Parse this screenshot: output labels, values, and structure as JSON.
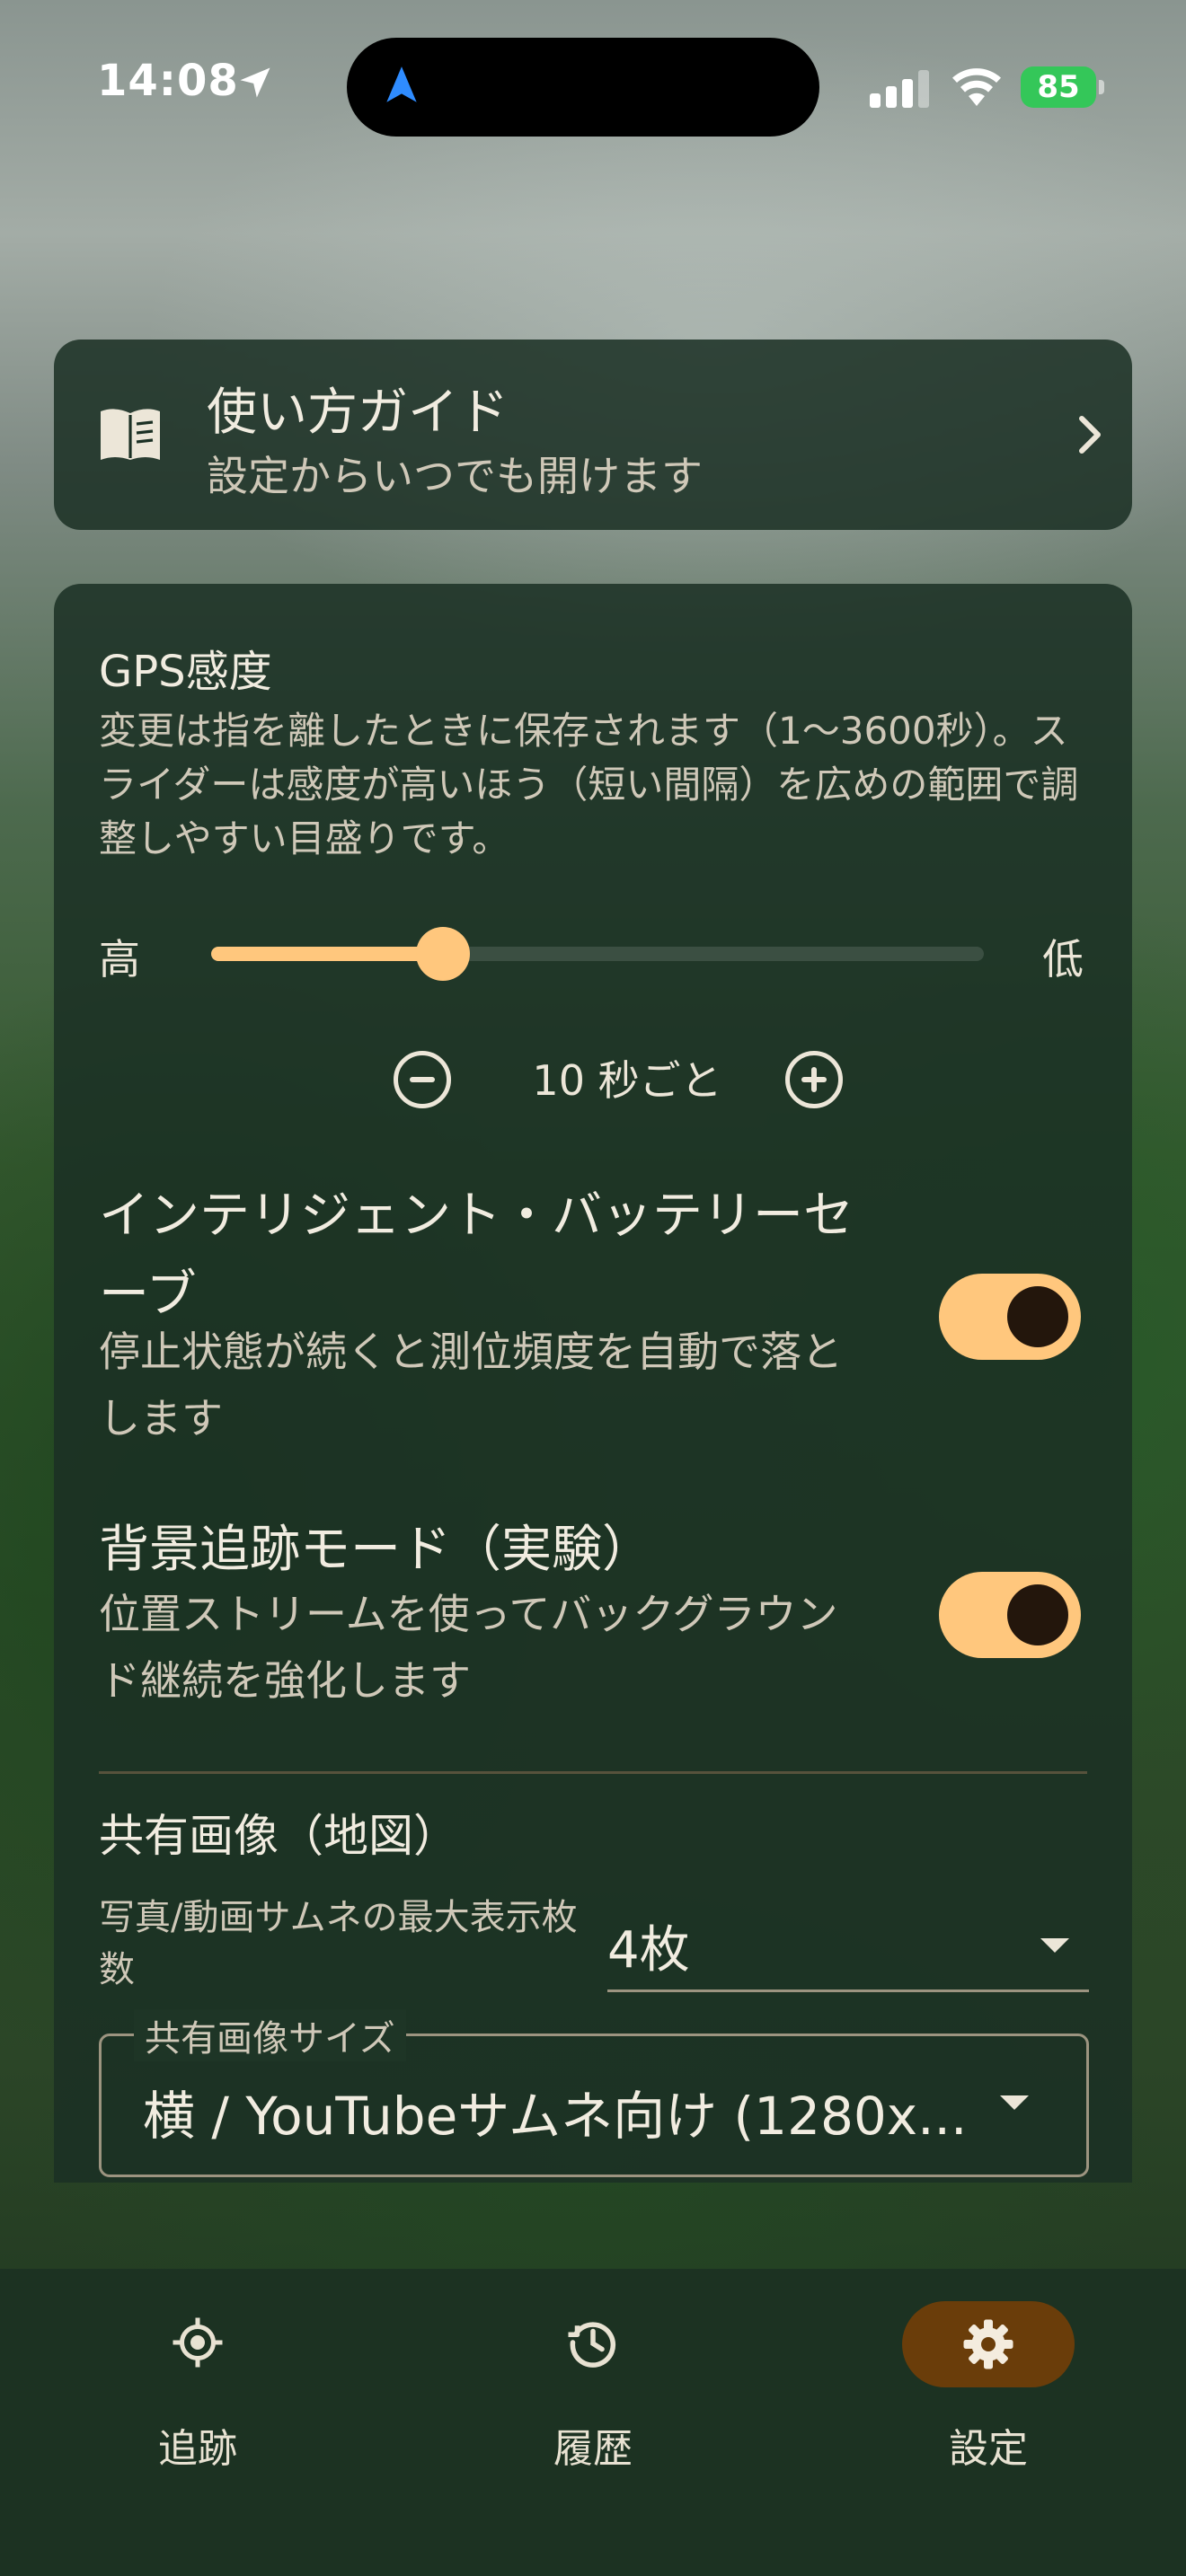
{
  "status_bar": {
    "time": "14:08",
    "battery": "85",
    "icons": [
      "location-arrow-icon",
      "navigation-icon",
      "cellular-signal-icon",
      "wifi-icon",
      "battery-icon"
    ]
  },
  "guide": {
    "title": "使い方ガイド",
    "subtitle": "設定からいつでも開けます",
    "icon": "book-icon"
  },
  "gps": {
    "title": "GPS感度",
    "description": "変更は指を離したときに保存されます（1〜3600秒）。スライダーは感度が高いほう（短い間隔）を広めの範囲で調整しやすい目盛りです。",
    "slider_left": "高",
    "slider_right": "低",
    "slider_position": 0.3,
    "interval_text": "10 秒ごと"
  },
  "options": [
    {
      "title": "インテリジェント・バッテリーセーブ",
      "description": "停止状態が続くと測位頻度を自動で落とします",
      "enabled": true
    },
    {
      "title": "背景追跡モード（実験）",
      "description": "位置ストリームを使ってバックグラウンド継続を強化します",
      "enabled": true
    }
  ],
  "share": {
    "title": "共有画像（地図）",
    "max_label": "写真/動画サムネの最大表示枚数",
    "max_value": "4枚",
    "size_label": "共有画像サイズ",
    "size_value": "横 / YouTubeサムネ向け (1280x..."
  },
  "nav": {
    "items": [
      {
        "label": "追跡",
        "icon": "gps-target-icon"
      },
      {
        "label": "履歴",
        "icon": "history-icon"
      },
      {
        "label": "設定",
        "icon": "gear-icon",
        "active": true
      }
    ]
  },
  "colors": {
    "accent": "#ffc77d",
    "card": "#1b3024",
    "nav_active": "#6a3d0a"
  }
}
